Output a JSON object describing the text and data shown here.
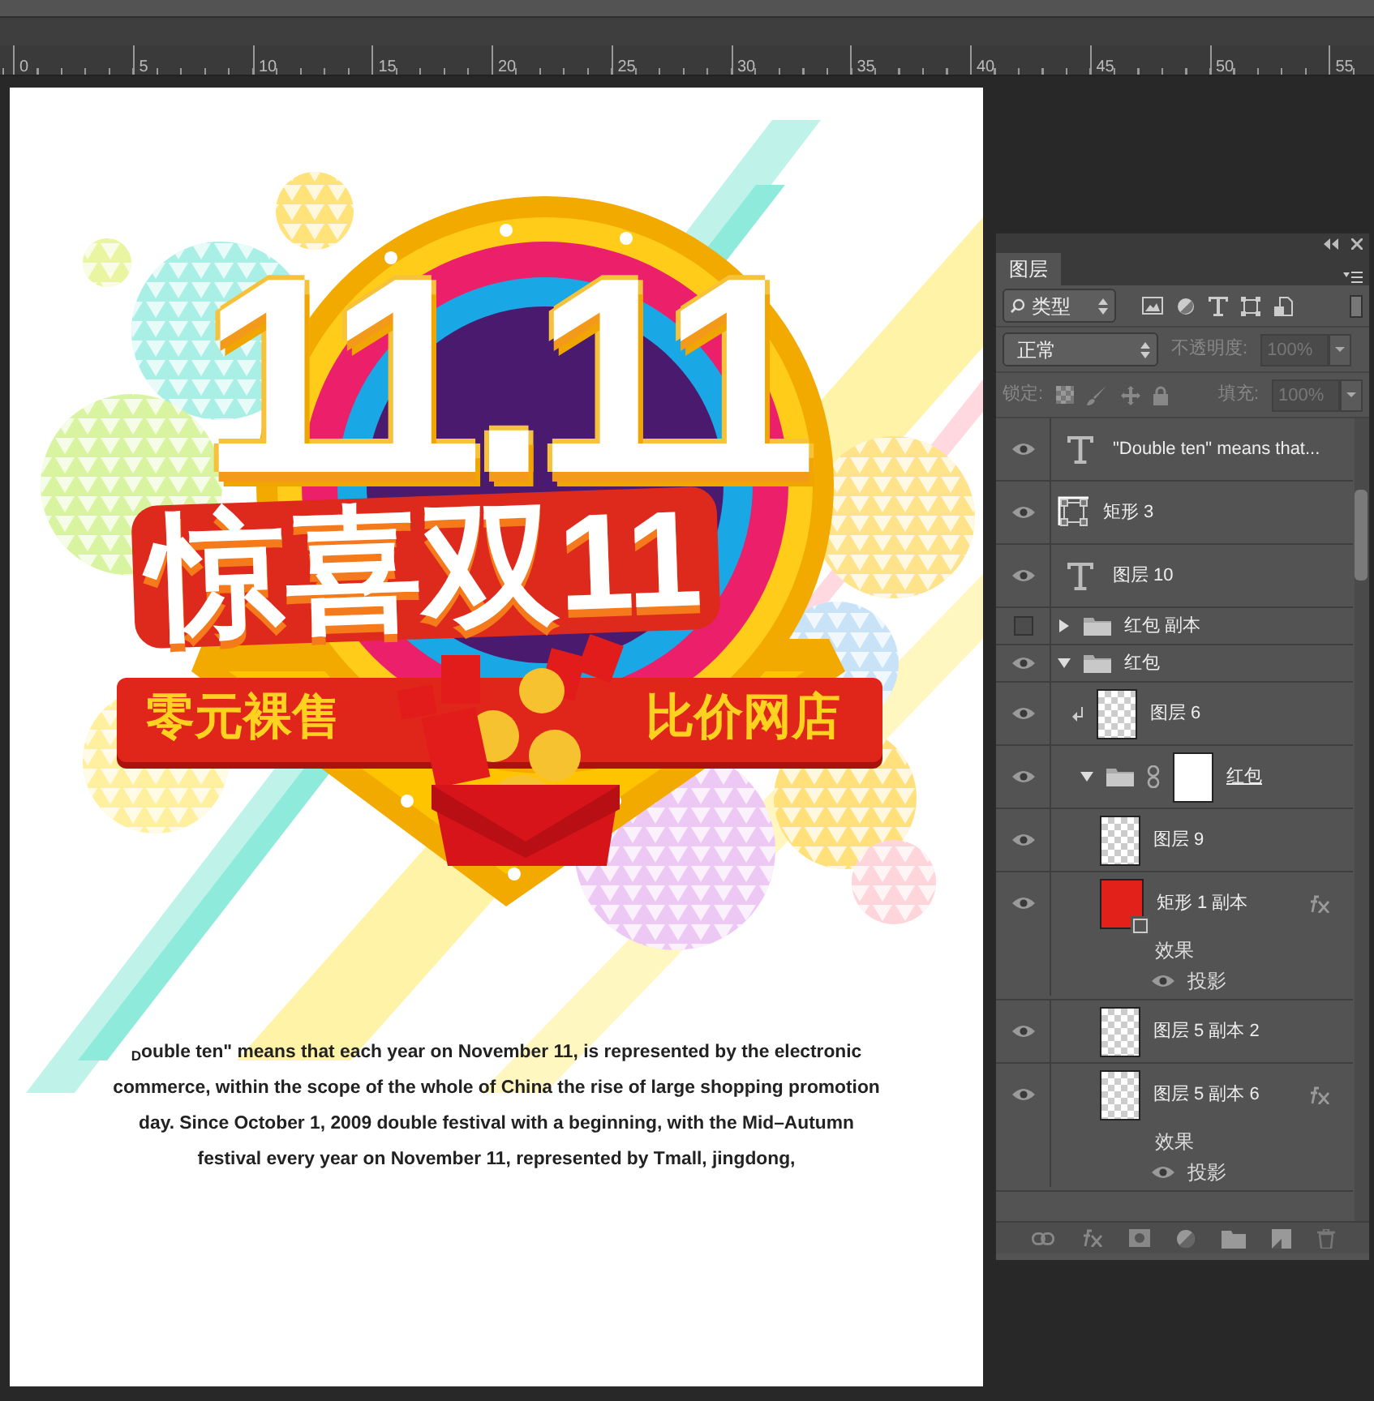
{
  "ruler": {
    "labels": [
      "0",
      "5",
      "10",
      "15",
      "20",
      "25",
      "30",
      "35",
      "40",
      "45",
      "50",
      "55"
    ]
  },
  "poster": {
    "headline": "11.11",
    "title": "惊喜双11",
    "banner_left": "零元裸售",
    "banner_right": "比价网店",
    "paragraph": "$_{D}$ouble ten\" means that each year on November 11, is represented by the electronic commerce, within the scope of the whole of China the rise of large shopping promotion day. Since October 1, 2009 double festival with a beginning, with the Mid–Autumn festival every year on November 11, represented by Tmall, jingdong,"
  },
  "layers_panel": {
    "tab": {
      "label": "图层",
      "selected": true
    },
    "filter": {
      "value": "类型"
    },
    "blend_mode": {
      "value": "正常"
    },
    "opacity": {
      "label": "不透明度:",
      "value": "100%",
      "disabled": true
    },
    "lock": {
      "label": "锁定:"
    },
    "fill": {
      "label": "填充:",
      "value": "100%",
      "disabled": true
    },
    "layers": [
      {
        "kind": "text",
        "name": "\"Double ten\" means that...",
        "visible": true,
        "selected": false
      },
      {
        "kind": "shape",
        "name": "矩形 3",
        "visible": true,
        "selected": false
      },
      {
        "kind": "text",
        "name": "图层 10",
        "visible": true,
        "selected": false
      },
      {
        "kind": "group",
        "name": "红包 副本",
        "visible": false,
        "expanded": false,
        "selected": false
      },
      {
        "kind": "group",
        "name": "红包",
        "visible": true,
        "expanded": true,
        "selected": false,
        "children": [
          {
            "kind": "pixel",
            "name": "图层 6",
            "visible": true,
            "clipped": true,
            "selected": false
          },
          {
            "kind": "group",
            "name": "红包",
            "visible": true,
            "expanded": true,
            "has_mask": true,
            "selected": false,
            "children": [
              {
                "kind": "pixel",
                "name": "图层 9",
                "visible": true,
                "selected": false
              },
              {
                "kind": "shape",
                "name": "矩形 1 副本",
                "visible": true,
                "fx": true,
                "selected": false,
                "effects": {
                  "label": "效果",
                  "items": [
                    {
                      "name": "投影",
                      "visible": true
                    }
                  ]
                }
              },
              {
                "kind": "pixel",
                "name": "图层 5 副本 2",
                "visible": true,
                "selected": false
              },
              {
                "kind": "pixel",
                "name": "图层 5 副本 6",
                "visible": true,
                "fx": true,
                "selected": false,
                "effects": {
                  "label": "效果",
                  "items": [
                    {
                      "name": "投影",
                      "visible": true
                    }
                  ]
                }
              }
            ]
          }
        ]
      }
    ]
  }
}
